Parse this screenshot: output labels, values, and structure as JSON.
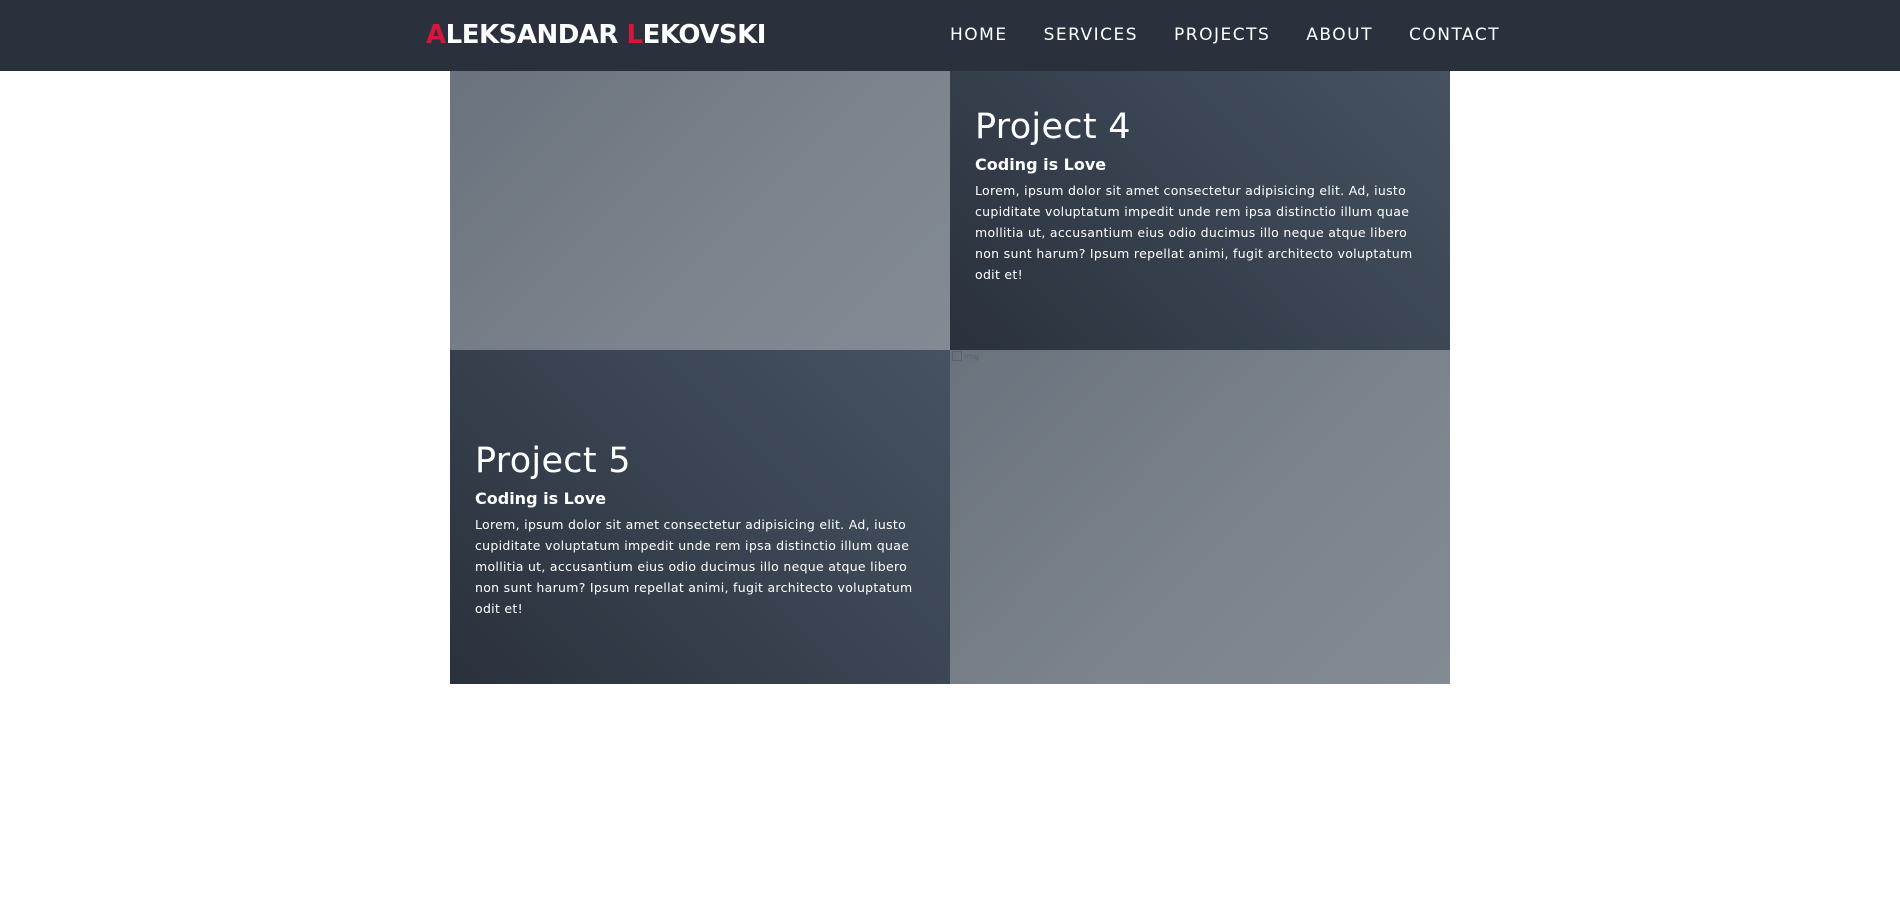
{
  "header": {
    "brand_first_initial": "A",
    "brand_first_rest": "LEKSANDAR",
    "brand_last_initial": "L",
    "brand_last_rest": "EKOVSKI",
    "nav": [
      "HOME",
      "SERVICES",
      "PROJECTS",
      "ABOUT",
      "CONTACT"
    ]
  },
  "colors": {
    "navbar_bg": "#2a313c",
    "accent": "#d4173a"
  },
  "projects": [
    {
      "title": "Project 4",
      "subtitle": "Coding is Love",
      "description": "Lorem, ipsum dolor sit amet consectetur adipisicing elit. Ad, iusto cupiditate voluptatum impedit unde rem ipsa distinctio illum quae mollitia ut, accusantium eius odio ducimus illo neque atque libero non sunt harum? Ipsum repellat animi, fugit architecto voluptatum odit et!"
    },
    {
      "title": "Project 5",
      "subtitle": "Coding is Love",
      "description": "Lorem, ipsum dolor sit amet consectetur adipisicing elit. Ad, iusto cupiditate voluptatum impedit unde rem ipsa distinctio illum quae mollitia ut, accusantium eius odio ducimus illo neque atque libero non sunt harum? Ipsum repellat animi, fugit architecto voluptatum odit et!"
    }
  ],
  "broken_image_alt": "img"
}
